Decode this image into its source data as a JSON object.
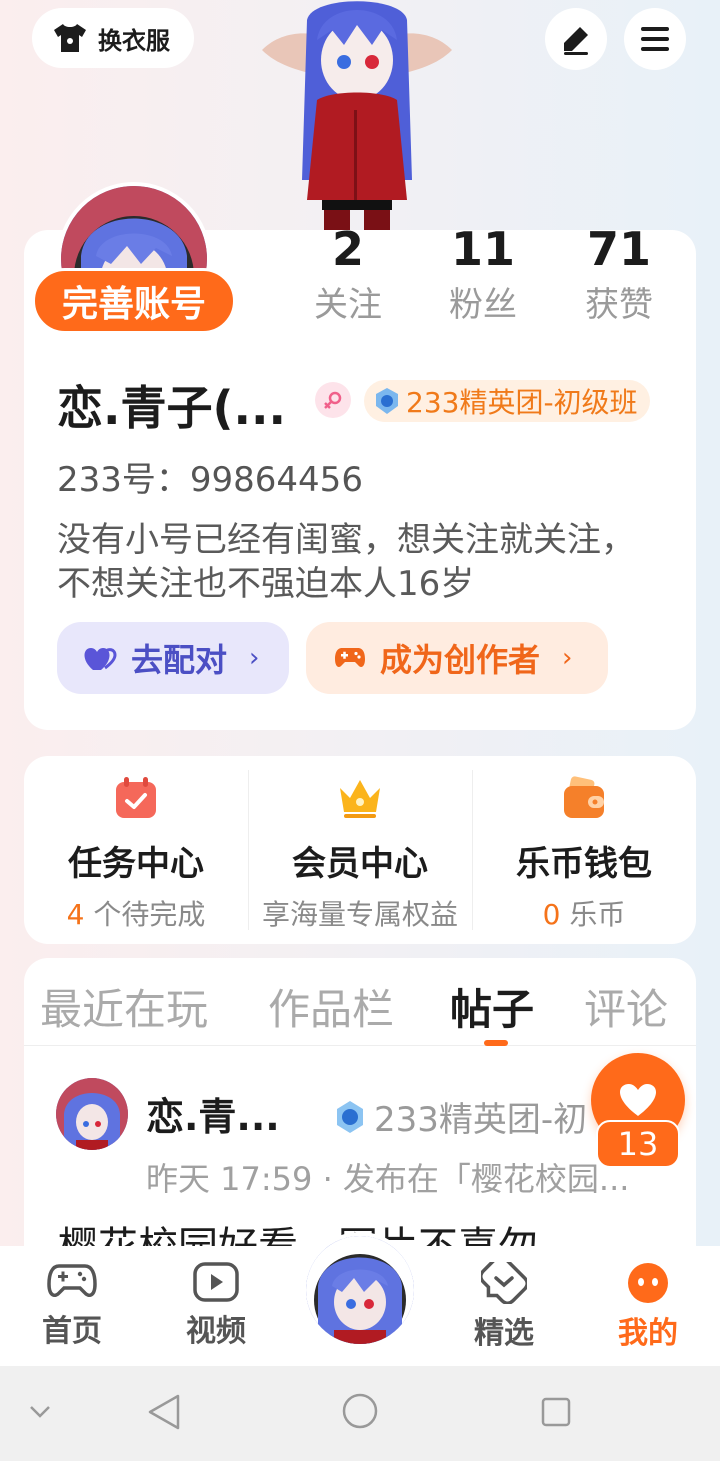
{
  "topbar": {
    "outfit_label": "换衣服",
    "edit_icon": "pen-icon",
    "menu_icon": "menu-icon"
  },
  "profile": {
    "complete_label": "完善账号",
    "stats": [
      {
        "value": "2",
        "label": "关注"
      },
      {
        "value": "11",
        "label": "粉丝"
      },
      {
        "value": "71",
        "label": "获赞"
      }
    ],
    "username": "恋.青子(...",
    "gender_icon": "female-icon",
    "badge": "233精英团-初级班",
    "uid": "233号：99864456",
    "bio": "没有小号已经有闺蜜，想关注就关注，不想关注也不强迫本人16岁",
    "pair_label": "去配对",
    "creator_label": "成为创作者"
  },
  "quick": [
    {
      "title": "任务中心",
      "highlight": "4",
      "sub": " 个待完成",
      "icon": "calendar-check-icon"
    },
    {
      "title": "会员中心",
      "highlight": "",
      "sub": "享海量专属权益",
      "icon": "crown-icon"
    },
    {
      "title": "乐币钱包",
      "highlight": "0",
      "sub": " 乐币",
      "icon": "wallet-icon"
    }
  ],
  "tabs": [
    {
      "label": "最近在玩"
    },
    {
      "label": "作品栏"
    },
    {
      "label": "帖子"
    },
    {
      "label": "评论"
    }
  ],
  "post": {
    "author": "恋.青...",
    "badge": "233精英团-初",
    "meta": "昨天 17:59 · 发布在「樱花校园...",
    "title": "樱花校园好看…图片不喜勿"
  },
  "like": {
    "count": "13"
  },
  "nav": [
    {
      "label": "首页",
      "icon": "gamepad-icon"
    },
    {
      "label": "视频",
      "icon": "play-icon"
    },
    {
      "label": "精选",
      "icon": "heart-chat-icon"
    },
    {
      "label": "我的",
      "icon": "smile-icon"
    }
  ],
  "colors": {
    "accent": "#ff6a1a",
    "pair": "#4b4fc4"
  }
}
